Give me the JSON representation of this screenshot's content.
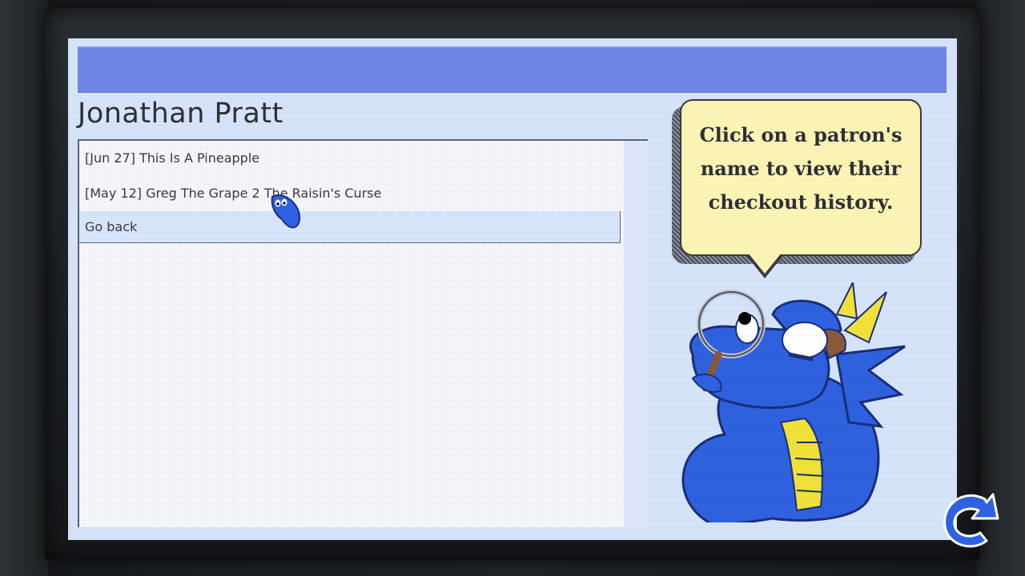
{
  "screen": {
    "patron_name": "Jonathan Pratt",
    "history": [
      {
        "label": "[Jun 27] This Is A Pineapple"
      },
      {
        "label": "[May 12] Greg The Grape 2 The Raisin's Curse"
      }
    ],
    "back_label": "Go back"
  },
  "help_bubble": {
    "line1": "Click on a patron's",
    "line2": "name to view their",
    "line3": "checkout history."
  },
  "colors": {
    "title_bar": "#6f86e8",
    "screen_bg": "#d7e5fb",
    "bubble_bg": "#fdf6b6",
    "dragon_blue": "#2f62e0",
    "dragon_yellow": "#f2e23a"
  },
  "icons": {
    "mascot": "detective-dragon",
    "cursor": "blue-fish-cursor",
    "back": "curved-back-arrow-icon"
  }
}
